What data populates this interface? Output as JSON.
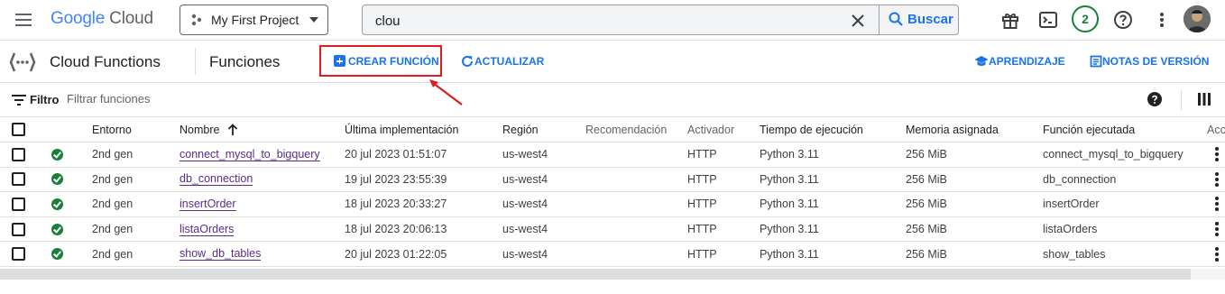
{
  "header": {
    "logo_google": "Google",
    "logo_cloud": "Cloud",
    "project_name": "My First Project",
    "search_value": "clou",
    "search_button": "Buscar",
    "notifications_count": "2"
  },
  "subheader": {
    "product_title": "Cloud Functions",
    "page_title": "Funciones",
    "create_label": "CREAR FUNCIÓN",
    "refresh_label": "ACTUALIZAR",
    "learn_label": "APRENDIZAJE",
    "release_notes_label": "NOTAS DE VERSIÓN"
  },
  "filter": {
    "label": "Filtro",
    "placeholder": "Filtrar funciones"
  },
  "table": {
    "columns": {
      "entorno": "Entorno",
      "nombre": "Nombre",
      "ultima": "Última implementación",
      "region": "Región",
      "recomendacion": "Recomendación",
      "activador": "Activador",
      "tiempo": "Tiempo de ejecución",
      "memoria": "Memoria asignada",
      "funcion": "Función ejecutada",
      "acciones": "Acc"
    },
    "rows": [
      {
        "entorno": "2nd gen",
        "nombre": "connect_mysql_to_bigquery",
        "ultima": "20 jul 2023 01:51:07",
        "region": "us-west4",
        "activador": "HTTP",
        "tiempo": "Python 3.11",
        "memoria": "256 MiB",
        "funcion": "connect_mysql_to_bigquery"
      },
      {
        "entorno": "2nd gen",
        "nombre": "db_connection",
        "ultima": "19 jul 2023 23:55:39",
        "region": "us-west4",
        "activador": "HTTP",
        "tiempo": "Python 3.11",
        "memoria": "256 MiB",
        "funcion": "db_connection"
      },
      {
        "entorno": "2nd gen",
        "nombre": "insertOrder",
        "ultima": "18 jul 2023 20:33:27",
        "region": "us-west4",
        "activador": "HTTP",
        "tiempo": "Python 3.11",
        "memoria": "256 MiB",
        "funcion": "insertOrder"
      },
      {
        "entorno": "2nd gen",
        "nombre": "listaOrders",
        "ultima": "18 jul 2023 20:06:13",
        "region": "us-west4",
        "activador": "HTTP",
        "tiempo": "Python 3.11",
        "memoria": "256 MiB",
        "funcion": "listaOrders"
      },
      {
        "entorno": "2nd gen",
        "nombre": "show_db_tables",
        "ultima": "20 jul 2023 01:22:05",
        "region": "us-west4",
        "activador": "HTTP",
        "tiempo": "Python 3.11",
        "memoria": "256 MiB",
        "funcion": "show_tables"
      }
    ]
  },
  "colors": {
    "accent": "#1a73e8",
    "status_ok": "#188038",
    "highlight": "#e01c1c",
    "link": "#5b2c8a"
  }
}
